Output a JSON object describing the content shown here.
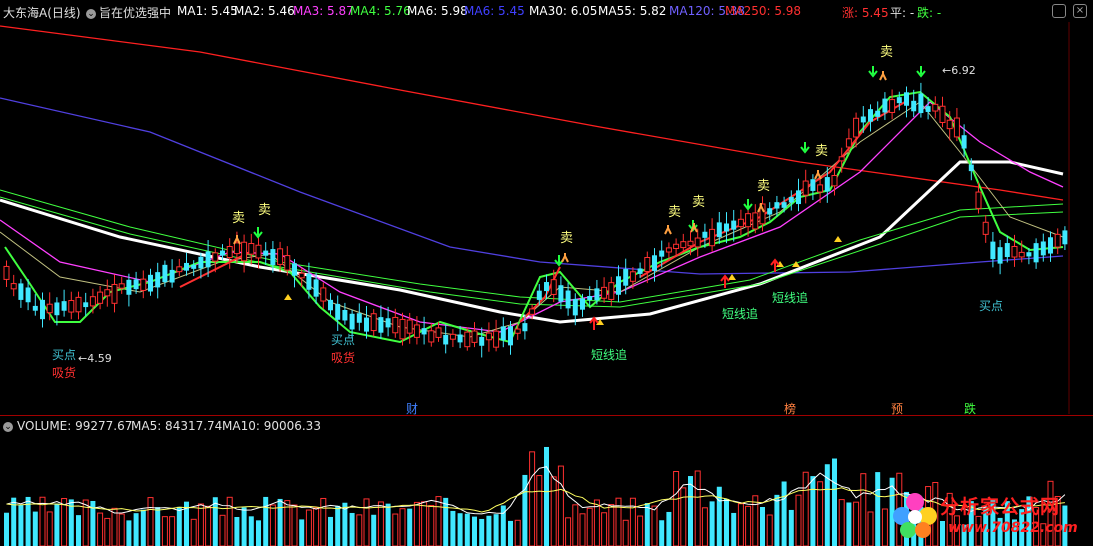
{
  "header": {
    "stock_title": "大东海A(日线)",
    "indicator_name": "旨在优选强中",
    "ma_items": [
      {
        "label": "MA1: 5.45",
        "color": "#ffffff"
      },
      {
        "label": "MA2: 5.46",
        "color": "#ffffff"
      },
      {
        "label": "MA3: 5.87",
        "color": "#ff40ff"
      },
      {
        "label": "MA4: 5.76",
        "color": "#40ff40"
      },
      {
        "label": "MA6: 5.98",
        "color": "#ffffff"
      },
      {
        "label": "MA6: 5.45",
        "color": "#4040ff"
      },
      {
        "label": "MA30: 6.05",
        "color": "#ffffff"
      },
      {
        "label": "MA55: 5.82",
        "color": "#ffffff"
      },
      {
        "label": "MA120: 5.38",
        "color": "#7060ff"
      },
      {
        "label": "MA250: 5.98",
        "color": "#ff3030"
      }
    ],
    "zhang": "涨: 5.45",
    "ping": "平: -",
    "die": "跌: -"
  },
  "annotations": {
    "sell": "卖",
    "buy_point": "买点",
    "absorb": "吸货",
    "short_chase": "短线追",
    "high_price": "6.92",
    "low_price": "4.59"
  },
  "events": [
    {
      "label": "财",
      "color": "#4080ff"
    },
    {
      "label": "榜",
      "color": "#ff8040"
    },
    {
      "label": "预",
      "color": "#ff8040"
    },
    {
      "label": "跌",
      "color": "#40ff40"
    }
  ],
  "volume": {
    "title": "VOLUME: 99277.67",
    "ma5": "MA5: 84317.74",
    "ma10": "MA10: 90006.33"
  },
  "watermark": {
    "title": "分析家公式网",
    "url": "www.70822.com"
  },
  "colors": {
    "up": "#ff3030",
    "down": "#40e8ff",
    "ma250": "#ff2020",
    "ma120": "#5040e0",
    "white_ma": "#ffffff",
    "green_ma": "#40ff40",
    "magenta_ma": "#ff40ff"
  }
}
